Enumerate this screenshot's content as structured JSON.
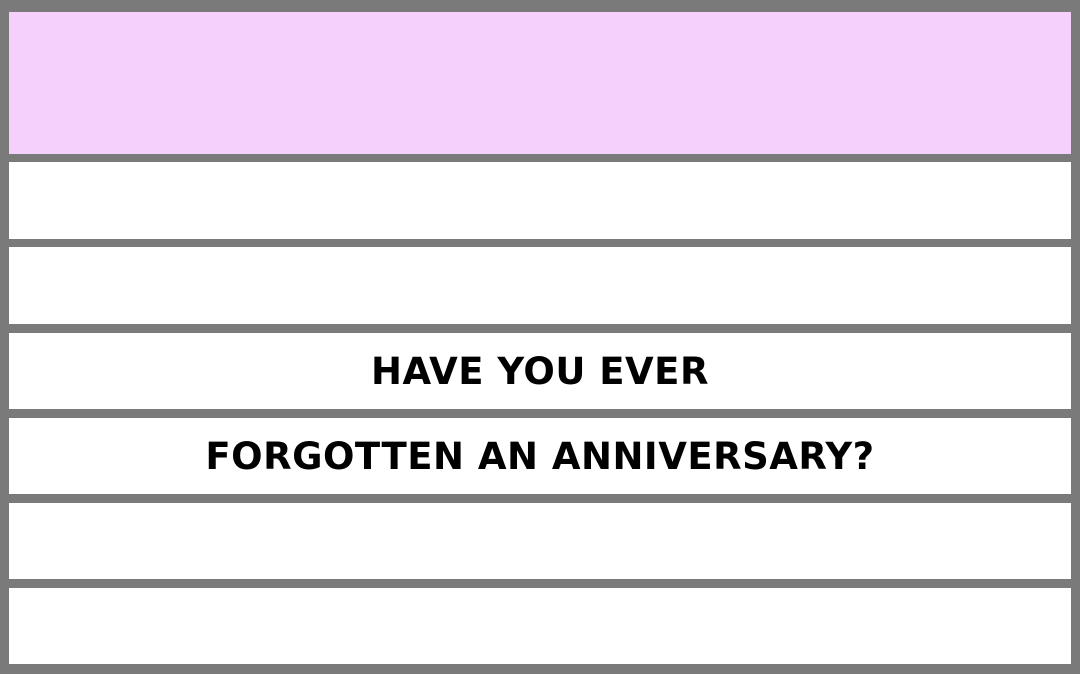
{
  "colors": {
    "frame": "#7a7a7a",
    "header_band": "#f5d0fd",
    "row_band": "#ffffff",
    "text": "#000000"
  },
  "message": {
    "line_1": "HAVE YOU EVER",
    "line_2": "FORGOTTEN AN ANNIVERSARY?"
  }
}
